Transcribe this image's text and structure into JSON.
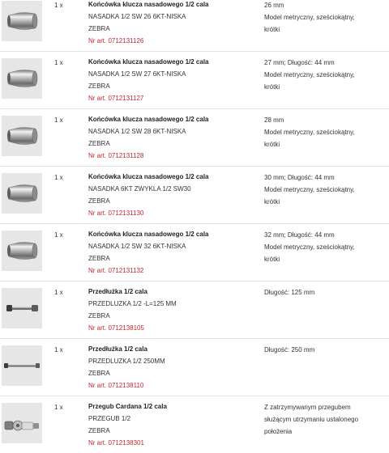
{
  "colors": {
    "article_number": "#c0282d",
    "separator": "#e2e2e2",
    "thumb_bg": "#e6e6e6"
  },
  "items": [
    {
      "icon": "socket-icon",
      "qty": "1 x",
      "title": "Końcówka klucza nasadowego 1/2 cala",
      "name": "NASADKA 1/2 SW 26 6KT-NISKA",
      "brand": "ZEBRA",
      "article": "Nr art. 0712131126",
      "spec_lines": [
        "26 mm",
        "Model metryczny, sześciokątny,",
        "krótki"
      ]
    },
    {
      "icon": "socket-icon",
      "qty": "1 x",
      "title": "Końcówka klucza nasadowego 1/2 cala",
      "name": "NASADKA 1/2 SW 27 6KT-NISKA",
      "brand": "ZEBRA",
      "article": "Nr art. 0712131127",
      "spec_lines": [
        "27 mm; Długość: 44 mm",
        "Model metryczny, sześciokątny,",
        "krótki"
      ]
    },
    {
      "icon": "socket-icon",
      "qty": "1 x",
      "title": "Końcówka klucza nasadowego 1/2 cala",
      "name": "NASADKA 1/2 SW 28 6KT-NISKA",
      "brand": "ZEBRA",
      "article": "Nr art. 0712131128",
      "spec_lines": [
        "28 mm",
        "Model metryczny, sześciokątny,",
        "krótki"
      ]
    },
    {
      "icon": "socket-icon",
      "qty": "1 x",
      "title": "Końcówka klucza nasadowego 1/2 cala",
      "name": "NASADKA 6KT ZWYKLA 1/2 SW30",
      "brand": "ZEBRA",
      "article": "Nr art. 0712131130",
      "spec_lines": [
        "30 mm; Długość: 44 mm",
        "Model metryczny, sześciokątny,",
        "krótki"
      ]
    },
    {
      "icon": "socket-icon",
      "qty": "1 x",
      "title": "Końcówka klucza nasadowego 1/2 cala",
      "name": "NASADKA 1/2 SW 32 6KT-NISKA",
      "brand": "ZEBRA",
      "article": "Nr art. 0712131132",
      "spec_lines": [
        "32 mm; Długość: 44 mm",
        "Model metryczny, sześciokątny,",
        "krótki"
      ]
    },
    {
      "icon": "extension-bar-icon",
      "qty": "1 x",
      "title": "Przedłużka 1/2 cala",
      "name": "PRZEDLUZKA 1/2 -L=125 MM",
      "brand": "ZEBRA",
      "article": "Nr art. 0712138105",
      "spec_lines": [
        "Długość: 125 mm"
      ]
    },
    {
      "icon": "extension-bar-long-icon",
      "qty": "1 x",
      "title": "Przedłużka 1/2 cala",
      "name": "PRZEDLUZKA 1/2 250MM",
      "brand": "ZEBRA",
      "article": "Nr art. 0712138110",
      "spec_lines": [
        "Długość: 250 mm"
      ]
    },
    {
      "icon": "universal-joint-icon",
      "qty": "1 x",
      "title": "Przegub Cardana 1/2 cala",
      "name": "PRZEGUB 1/2",
      "brand": "ZEBRA",
      "article": "Nr art. 0712138301",
      "spec_lines": [
        "Z zatrzymywanym przegubem",
        "służącym utrzymaniu ustalonego",
        "położenia"
      ]
    }
  ]
}
